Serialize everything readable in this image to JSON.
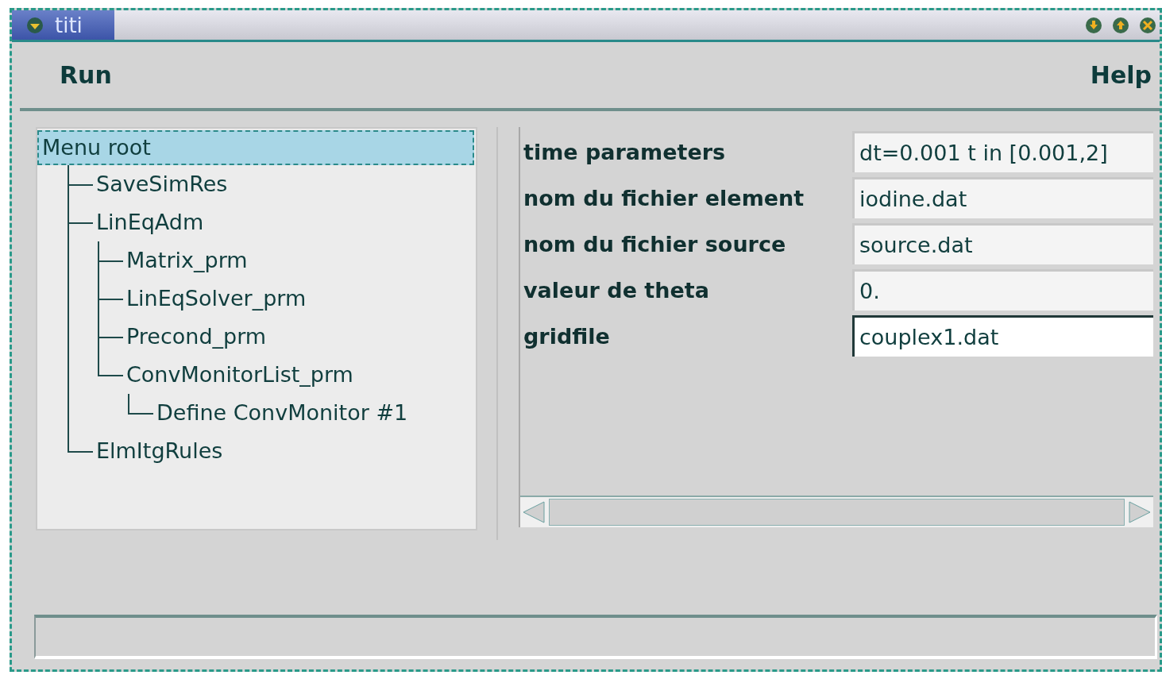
{
  "window": {
    "title": "titi"
  },
  "menu": [
    {
      "label": "Run"
    },
    {
      "label": "Help"
    }
  ],
  "tree": [
    {
      "label": "Menu root",
      "selected": true,
      "children": [
        {
          "label": "SaveSimRes",
          "selected": false
        },
        {
          "label": "LinEqAdm",
          "selected": false,
          "children": [
            {
              "label": "Matrix_prm",
              "selected": false
            },
            {
              "label": "LinEqSolver_prm",
              "selected": false
            },
            {
              "label": "Precond_prm",
              "selected": false
            },
            {
              "label": "ConvMonitorList_prm",
              "selected": false,
              "children": [
                {
                  "label": "Define ConvMonitor #1",
                  "selected": false
                }
              ]
            }
          ]
        },
        {
          "label": "ElmItgRules",
          "selected": false
        }
      ]
    }
  ],
  "parameters": [
    {
      "label": "time parameters",
      "value": "dt=0.001 t in [0.001,2]",
      "focused": false
    },
    {
      "label": "nom du fichier element",
      "value": "iodine.dat",
      "focused": false
    },
    {
      "label": "nom du fichier source",
      "value": "source.dat",
      "focused": false
    },
    {
      "label": "valeur de theta",
      "value": "0.",
      "focused": false
    },
    {
      "label": "gridfile",
      "value": "couplex1.dat",
      "focused": true
    }
  ]
}
